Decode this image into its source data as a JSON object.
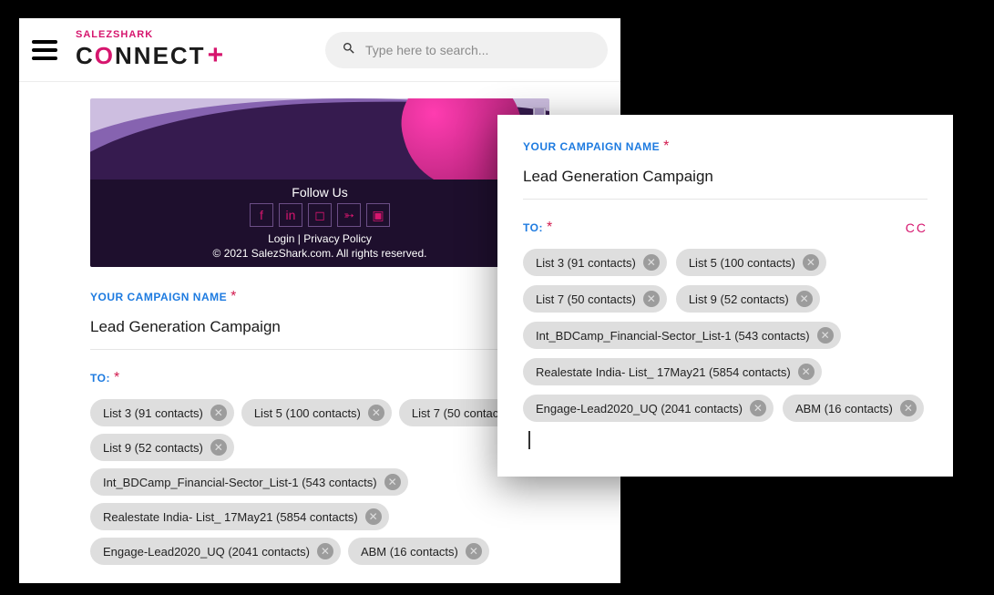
{
  "header": {
    "brand_sub": "SALEZSHARK",
    "brand_main_a": "C",
    "brand_main_o": "O",
    "brand_main_b": "NNECT",
    "brand_plus": "+",
    "search_placeholder": "Type here to search..."
  },
  "preview": {
    "follow_title": "Follow Us",
    "login_link": "Login",
    "sep": " | ",
    "privacy_link": "Privacy Policy",
    "copyright": "© 2021 SalezShark.com. All rights reserved."
  },
  "form": {
    "name_label": "YOUR CAMPAIGN NAME",
    "name_value": "Lead Generation Campaign",
    "to_label": "TO:",
    "cc_label": "CC",
    "chips": [
      "List 3 (91 contacts)",
      "List 5 (100 contacts)",
      "List 7 (50 contacts)",
      "List 9 (52 contacts)",
      "Int_BDCamp_Financial-Sector_List-1 (543 contacts)",
      "Realestate India- List_ 17May21 (5854 contacts)",
      "Engage-Lead2020_UQ (2041 contacts)",
      "ABM (16 contacts)"
    ]
  }
}
